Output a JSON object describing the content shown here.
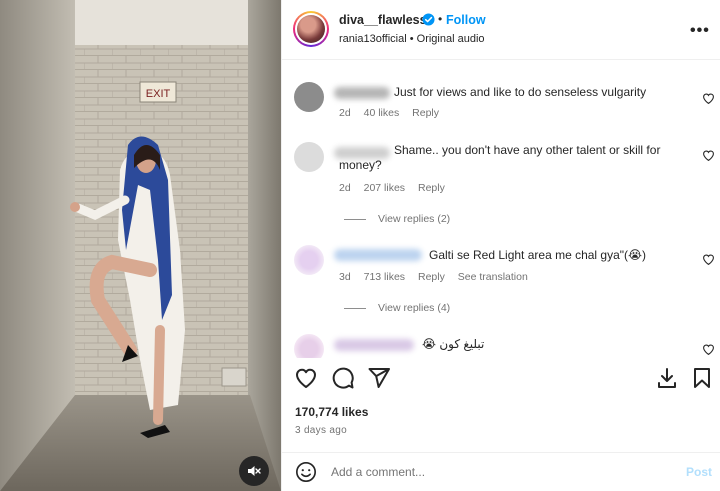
{
  "post": {
    "username": "diva__flawless",
    "follow_label": "Follow",
    "separator": "•",
    "subtitle": "rania13official • Original audio",
    "more_label": "•••"
  },
  "media": {
    "sign_text": "EXIT",
    "mute_icon": "speaker-muted-icon"
  },
  "comments": [
    {
      "text": "Just for views and like to do senseless vulgarity",
      "age": "2d",
      "likes": "40 likes",
      "reply": "Reply"
    },
    {
      "text": "Shame.. you don't have any other talent or skill for money?",
      "age": "2d",
      "likes": "207 likes",
      "reply": "Reply",
      "view_replies": "View replies (2)"
    },
    {
      "text": "Galti se Red Light area me chal gya\"(😭)",
      "age": "3d",
      "likes": "713 likes",
      "reply": "Reply",
      "translate": "See translation",
      "view_replies": "View replies (4)"
    },
    {
      "text": "تبليغ كون 😭"
    }
  ],
  "footer": {
    "likes": "170,774 likes",
    "ago": "3 days ago",
    "placeholder": "Add a comment...",
    "post_label": "Post"
  },
  "colors": {
    "accent": "#0095f6",
    "muted": "#737373"
  }
}
